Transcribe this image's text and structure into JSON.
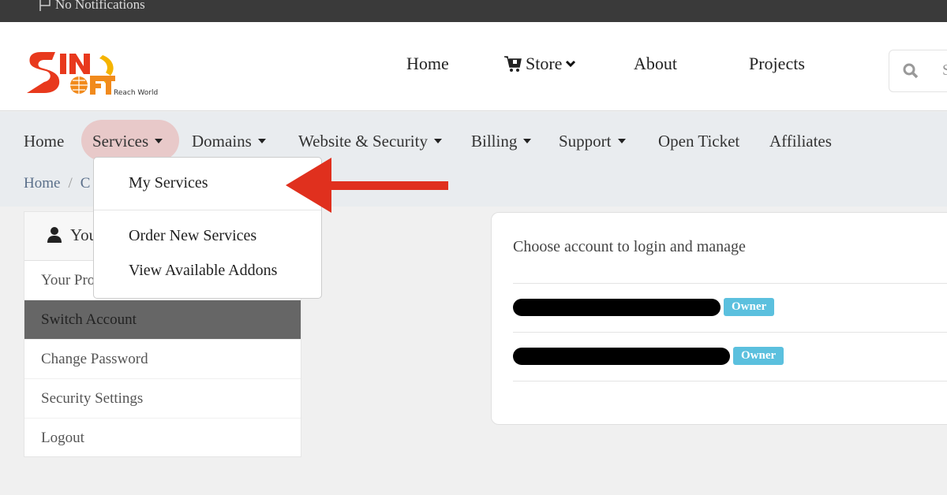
{
  "topbar": {
    "notifications_label": "No Notifications",
    "icon": "flag-icon"
  },
  "logo": {
    "brand_top": "SINO",
    "brand_bottom": "SOFT",
    "tagline": "Reach World"
  },
  "main_nav": {
    "items": [
      {
        "label": "Home"
      },
      {
        "label": "Store",
        "icon": "cart-icon",
        "has_dropdown": true
      },
      {
        "label": "About"
      },
      {
        "label": "Projects"
      }
    ],
    "search_placeholder": "S"
  },
  "sub_nav": {
    "items": [
      {
        "label": "Home",
        "has_dropdown": false
      },
      {
        "label": "Services",
        "has_dropdown": true,
        "active": true
      },
      {
        "label": "Domains",
        "has_dropdown": true
      },
      {
        "label": "Website & Security",
        "has_dropdown": true
      },
      {
        "label": "Billing",
        "has_dropdown": true
      },
      {
        "label": "Support",
        "has_dropdown": true
      },
      {
        "label": "Open Ticket",
        "has_dropdown": false
      },
      {
        "label": "Affiliates",
        "has_dropdown": false
      }
    ]
  },
  "breadcrumb": {
    "home": "Home",
    "separator": "/",
    "current": "C"
  },
  "services_dropdown": {
    "items": [
      {
        "label": "My Services"
      },
      {
        "label": "Order New Services"
      },
      {
        "label": "View Available Addons"
      }
    ]
  },
  "annotation": {
    "arrow_color": "#e0301e",
    "points_to": "My Services"
  },
  "sidebar": {
    "header": "Your Account",
    "header_visible": "You",
    "items": [
      {
        "label": "Your Profile",
        "visible": "Your Pro"
      },
      {
        "label": "Switch Account",
        "active": true
      },
      {
        "label": "Change Password"
      },
      {
        "label": "Security Settings"
      },
      {
        "label": "Logout"
      }
    ]
  },
  "accounts_card": {
    "title": "Choose account to login and manage",
    "accounts": [
      {
        "name_redacted": true,
        "role": "Owner"
      },
      {
        "name_redacted": true,
        "role": "Owner"
      }
    ]
  },
  "colors": {
    "topbar": "#3a3a3a",
    "subnav_bg": "#e9ecef",
    "active_pill": "#e8c9c9",
    "sidebar_active": "#666666",
    "badge": "#5bc0de",
    "arrow": "#e0301e"
  }
}
